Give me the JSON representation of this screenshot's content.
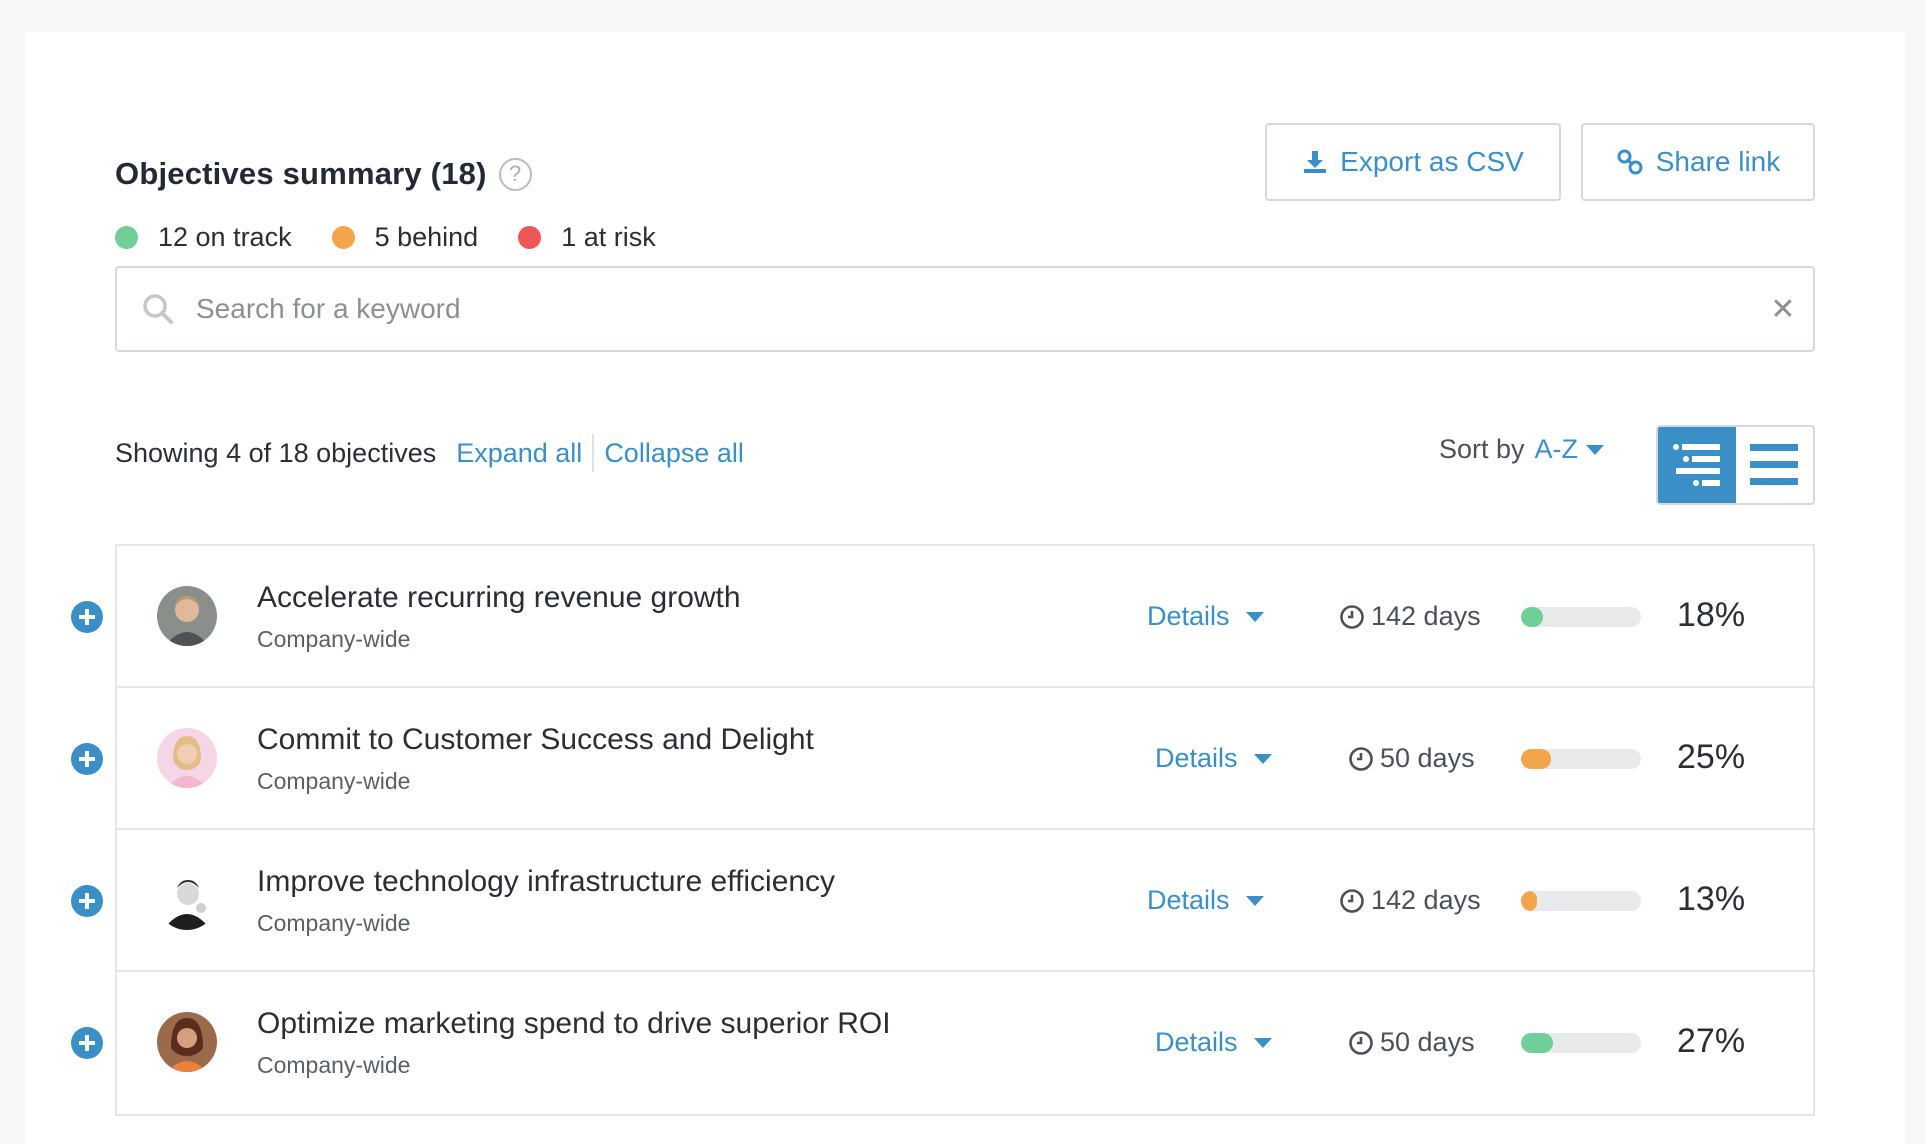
{
  "header": {
    "title": "Objectives summary (18)",
    "help_icon": "question-circle-icon"
  },
  "status": [
    {
      "label": "12 on track",
      "color": "#6fcf97"
    },
    {
      "label": "5 behind",
      "color": "#f2a54a"
    },
    {
      "label": "1 at risk",
      "color": "#eb5757"
    }
  ],
  "actions": {
    "export_label": "Export as CSV",
    "share_label": "Share link"
  },
  "search": {
    "placeholder": "Search for a keyword",
    "value": ""
  },
  "toolbar": {
    "showing": "Showing 4 of 18 objectives",
    "expand_all": "Expand all",
    "collapse_all": "Collapse all",
    "sort_prefix": "Sort by",
    "sort_value": "A-Z",
    "active_view": "hierarchy"
  },
  "colors": {
    "accent": "#3b8fc7",
    "on_track": "#6fcf97",
    "behind": "#f2a54a",
    "at_risk": "#eb5757"
  },
  "objectives": [
    {
      "title": "Accelerate recurring revenue growth",
      "scope": "Company-wide",
      "details": "Details",
      "days": "142 days",
      "progress": 18,
      "percent": "18%",
      "status": "on_track",
      "avatar": "man-light-hair"
    },
    {
      "title": "Commit to Customer Success and Delight",
      "scope": "Company-wide",
      "details": "Details",
      "days": "50 days",
      "progress": 25,
      "percent": "25%",
      "status": "behind",
      "avatar": "woman-blonde"
    },
    {
      "title": "Improve technology infrastructure efficiency",
      "scope": "Company-wide",
      "details": "Details",
      "days": "142 days",
      "progress": 13,
      "percent": "13%",
      "status": "behind",
      "avatar": "man-bw"
    },
    {
      "title": "Optimize marketing spend to drive superior ROI",
      "scope": "Company-wide",
      "details": "Details",
      "days": "50 days",
      "progress": 27,
      "percent": "27%",
      "status": "on_track",
      "avatar": "woman-dark-hair"
    }
  ]
}
